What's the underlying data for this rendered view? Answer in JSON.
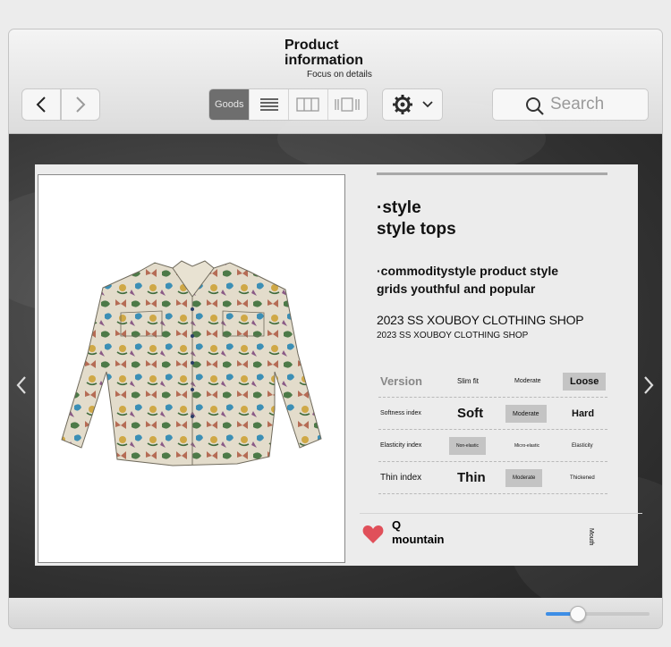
{
  "window": {
    "title": "Product information",
    "subtitle": "Focus on details"
  },
  "toolbar": {
    "back_icon": "chevron-left-icon",
    "forward_icon": "chevron-right-icon",
    "views": [
      {
        "label": "Goods",
        "icon": "goods-view",
        "active": true
      },
      {
        "label": "",
        "icon": "list-view-icon",
        "active": false
      },
      {
        "label": "",
        "icon": "column-view-icon",
        "active": false
      },
      {
        "label": "",
        "icon": "gallery-view-icon",
        "active": false
      }
    ],
    "action_icon": "gear-icon",
    "search_placeholder": "Search"
  },
  "product": {
    "image": "floral-butterfly-print-shirt",
    "style_title_1": "·style",
    "style_title_2": "style tops",
    "desc_1": "·commoditystyle product style",
    "desc_2": "grids youthful and popular",
    "shop": "2023 SS XOUBOY CLOTHING SHOP",
    "shop_small": "2023 SS XOUBOY CLOTHING SHOP",
    "attributes": [
      {
        "label": "Version",
        "options": [
          "Slim fit",
          "Moderate",
          "Loose"
        ],
        "selected": 2
      },
      {
        "label": "Softness index",
        "options": [
          "Soft",
          "Moderate",
          "Hard"
        ],
        "selected": 1
      },
      {
        "label": "Elasticity index",
        "options": [
          "Non-elastic",
          "Micro-elastic",
          "Elasticity"
        ],
        "selected": 0
      },
      {
        "label": "Thin index",
        "options": [
          "Thin",
          "Moderate",
          "Thickened"
        ],
        "selected": 1
      }
    ],
    "footer_q": "Q",
    "footer_name": "mountain",
    "footer_side": "Mouth"
  },
  "zoom": 0.31,
  "colors": {
    "accent": "#3d8ee6",
    "heart": "#e0505a"
  }
}
